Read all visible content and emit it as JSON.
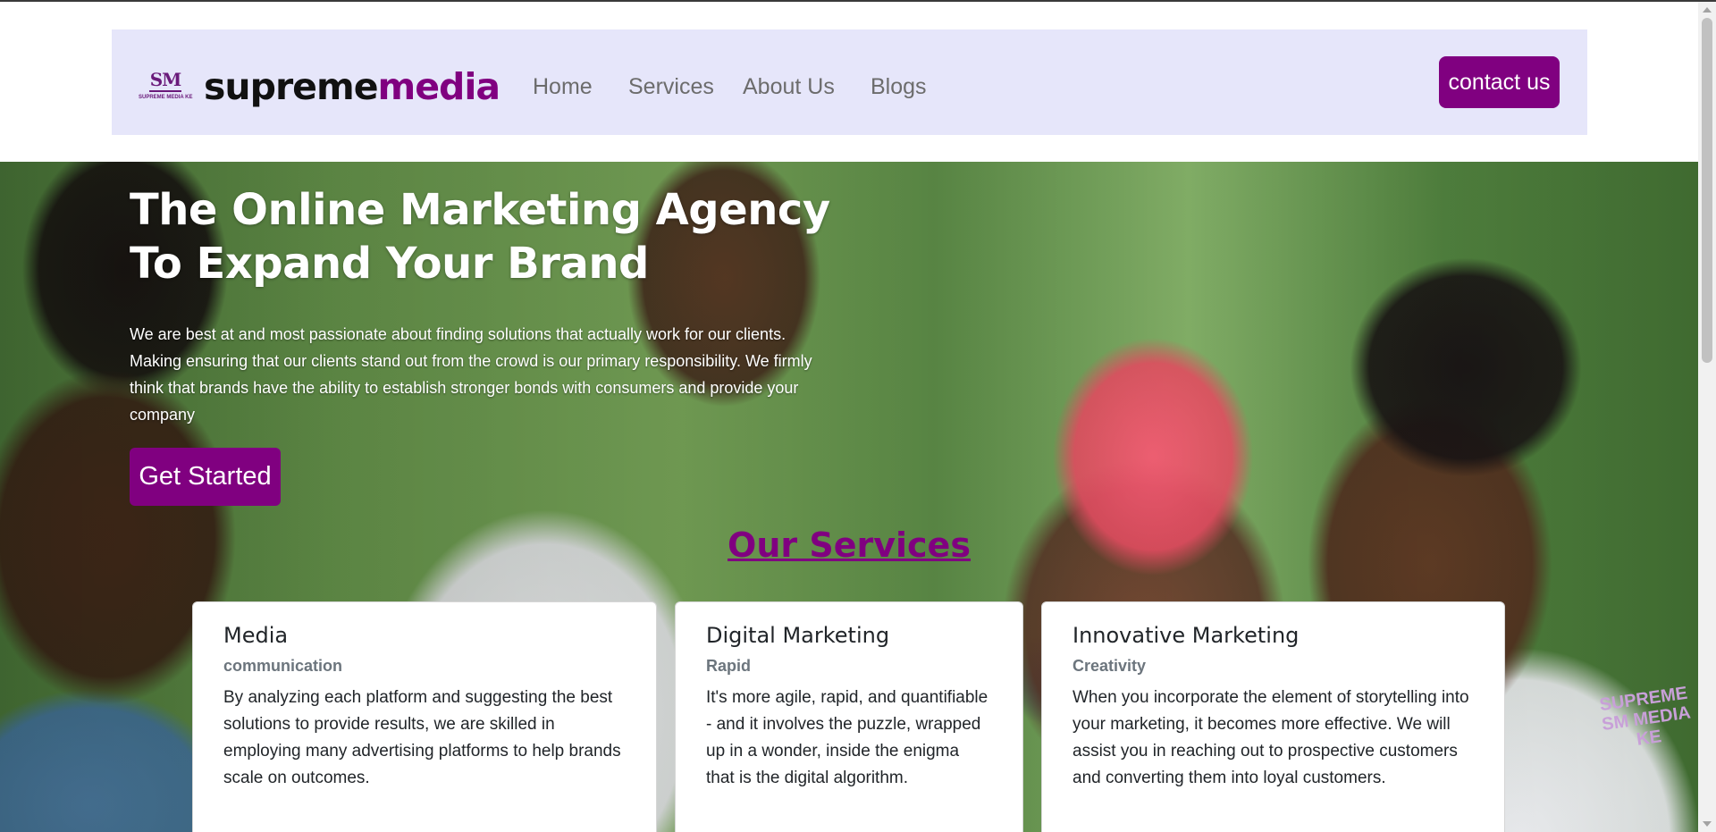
{
  "navbar": {
    "logo_mark": "SM",
    "logo_tagline": "SUPREME MEDIA KE",
    "brand_part1": "supreme",
    "brand_part2": "media",
    "links": [
      "Home",
      "Services",
      "About Us",
      "Blogs"
    ],
    "contact_label": "contact us"
  },
  "hero": {
    "title": "The Online Marketing Agency To Expand Your Brand",
    "text": "We are best at and most passionate about finding solutions that actually work for our clients. Making ensuring that our clients stand out from the crowd is our primary responsibility. We firmly think that brands have the ability to establish stronger bonds with consumers and provide your company",
    "cta_label": "Get Started",
    "watermark": "SUPREME SM MEDIA KE"
  },
  "services": {
    "heading": "Our Services",
    "cards": [
      {
        "title": "Media",
        "subtitle": "communication",
        "text": "By analyzing each platform and suggesting the best solutions to provide results, we are skilled in employing many advertising platforms to help brands scale on outcomes."
      },
      {
        "title": "Digital Marketing",
        "subtitle": "Rapid",
        "text": "It's more agile, rapid, and quantifiable - and it involves the puzzle, wrapped up in a wonder, inside the enigma that is the digital algorithm."
      },
      {
        "title": "Innovative Marketing",
        "subtitle": "Creativity",
        "text": "When you incorporate the element of storytelling into your marketing, it becomes more effective. We will assist you in reaching out to prospective customers and converting them into loyal customers."
      }
    ]
  },
  "colors": {
    "brand_purple": "#800080",
    "navbar_bg": "#e6e6fa"
  }
}
